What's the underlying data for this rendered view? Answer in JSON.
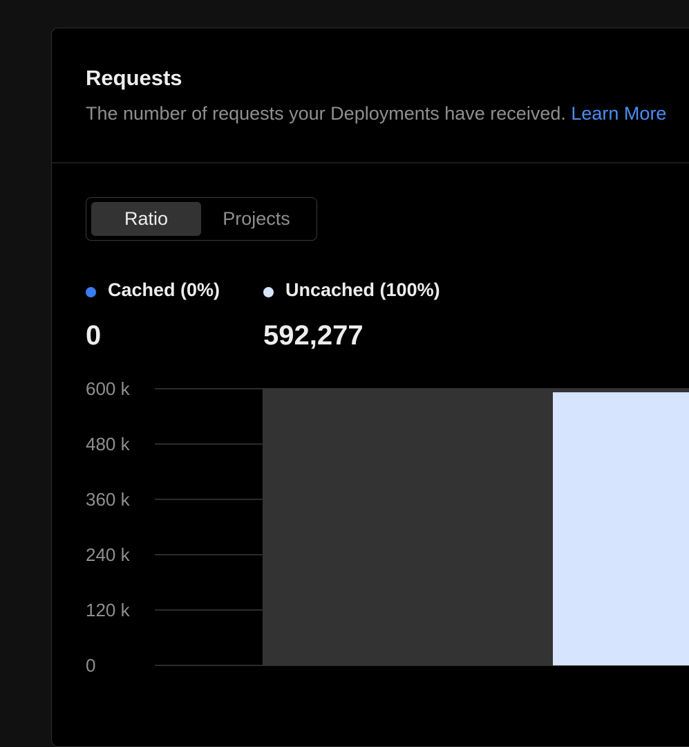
{
  "card": {
    "title": "Requests",
    "subtitle": "The number of requests your Deployments have received.",
    "learn_more": "Learn More"
  },
  "toggle": {
    "options": [
      "Ratio",
      "Projects"
    ],
    "selected": "Ratio"
  },
  "legend": [
    {
      "label": "Cached (0%)",
      "value": "0",
      "color": "#3b7cf0"
    },
    {
      "label": "Uncached (100%)",
      "value": "592,277",
      "color": "#d6e4fe"
    }
  ],
  "chart_data": {
    "type": "bar",
    "ylim": [
      0,
      600000
    ],
    "yticks": [
      0,
      120000,
      240000,
      360000,
      480000,
      600000
    ],
    "ytick_labels": [
      "0",
      "120 k",
      "240 k",
      "360 k",
      "480 k",
      "600 k"
    ],
    "series": [
      {
        "name": "Cached (0%)",
        "value": 0,
        "color": "#3b7cf0"
      },
      {
        "name": "Uncached (100%)",
        "value": 592277,
        "color": "#d6e4fe"
      }
    ],
    "background_bar_color": "#333333",
    "grid": true
  }
}
